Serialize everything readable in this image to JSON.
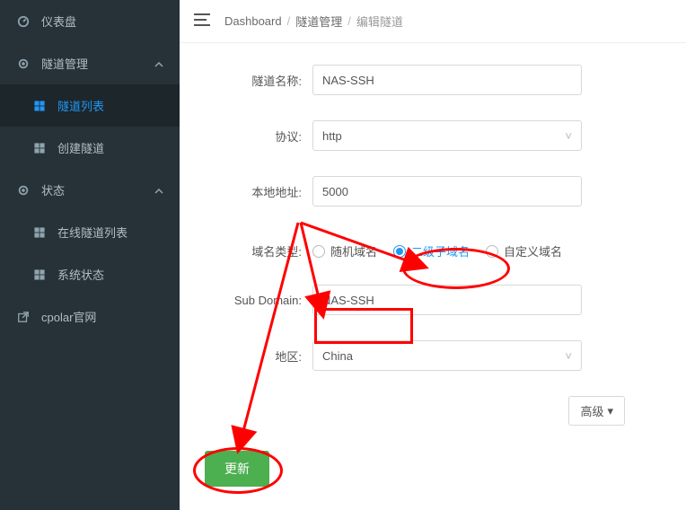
{
  "sidebar": {
    "items": [
      {
        "label": "仪表盘",
        "icon": "dashboard-icon"
      },
      {
        "label": "隧道管理",
        "icon": "gear-icon"
      },
      {
        "label": "隧道列表",
        "icon": "grid-icon"
      },
      {
        "label": "创建隧道",
        "icon": "grid-icon"
      },
      {
        "label": "状态",
        "icon": "gear-icon"
      },
      {
        "label": "在线隧道列表",
        "icon": "grid-icon"
      },
      {
        "label": "系统状态",
        "icon": "grid-icon"
      },
      {
        "label": "cpolar官网",
        "icon": "external-link-icon"
      }
    ]
  },
  "breadcrumb": {
    "a": "Dashboard",
    "b": "隧道管理",
    "c": "编辑隧道"
  },
  "form": {
    "tunnel_name_label": "隧道名称:",
    "tunnel_name_value": "NAS-SSH",
    "protocol_label": "协议:",
    "protocol_value": "http",
    "local_addr_label": "本地地址:",
    "local_addr_value": "5000",
    "domain_type_label": "域名类型:",
    "domain_type_options": [
      "随机域名",
      "二级子域名",
      "自定义域名"
    ],
    "domain_type_selected": 1,
    "subdomain_label": "Sub Domain:",
    "subdomain_value": "NAS-SSH",
    "region_label": "地区:",
    "region_value": "China",
    "advanced_label": "高级",
    "update_label": "更新"
  }
}
